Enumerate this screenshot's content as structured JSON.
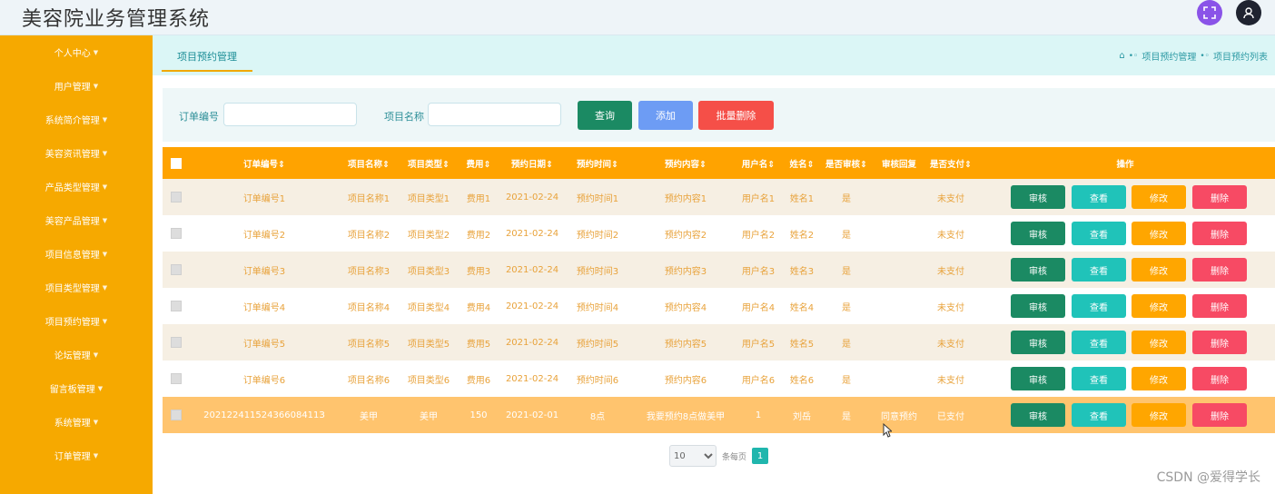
{
  "app": {
    "title": "美容院业务管理系统"
  },
  "topbar": {
    "fullscreen_icon": "expand-icon",
    "user_icon": "user-icon"
  },
  "sidebar": {
    "items": [
      {
        "label": "个人中心"
      },
      {
        "label": "用户管理"
      },
      {
        "label": "系统简介管理"
      },
      {
        "label": "美容资讯管理"
      },
      {
        "label": "产品类型管理"
      },
      {
        "label": "美容产品管理"
      },
      {
        "label": "项目信息管理"
      },
      {
        "label": "项目类型管理"
      },
      {
        "label": "项目预约管理"
      },
      {
        "label": "论坛管理"
      },
      {
        "label": "留言板管理"
      },
      {
        "label": "系统管理"
      },
      {
        "label": "订单管理"
      }
    ]
  },
  "tabs": {
    "active": "项目预约管理"
  },
  "breadcrumb": {
    "level1": "项目预约管理",
    "level2": "项目预约列表"
  },
  "search": {
    "order_label": "订单编号",
    "order_value": "",
    "project_label": "项目名称",
    "project_value": "",
    "query_label": "查询",
    "add_label": "添加",
    "batch_delete_label": "批量删除"
  },
  "table": {
    "headers": [
      "订单编号⇕",
      "项目名称⇕",
      "项目类型⇕",
      "费用⇕",
      "预约日期⇕",
      "预约时间⇕",
      "预约内容⇕",
      "用户名⇕",
      "姓名⇕",
      "是否审核⇕",
      "审核回复",
      "是否支付⇕",
      "操作"
    ],
    "rows": [
      [
        "订单编号1",
        "项目名称1",
        "项目类型1",
        "费用1",
        "2021-02-24",
        "预约时间1",
        "预约内容1",
        "用户名1",
        "姓名1",
        "是",
        "",
        "未支付"
      ],
      [
        "订单编号2",
        "项目名称2",
        "项目类型2",
        "费用2",
        "2021-02-24",
        "预约时间2",
        "预约内容2",
        "用户名2",
        "姓名2",
        "是",
        "",
        "未支付"
      ],
      [
        "订单编号3",
        "项目名称3",
        "项目类型3",
        "费用3",
        "2021-02-24",
        "预约时间3",
        "预约内容3",
        "用户名3",
        "姓名3",
        "是",
        "",
        "未支付"
      ],
      [
        "订单编号4",
        "项目名称4",
        "项目类型4",
        "费用4",
        "2021-02-24",
        "预约时间4",
        "预约内容4",
        "用户名4",
        "姓名4",
        "是",
        "",
        "未支付"
      ],
      [
        "订单编号5",
        "项目名称5",
        "项目类型5",
        "费用5",
        "2021-02-24",
        "预约时间5",
        "预约内容5",
        "用户名5",
        "姓名5",
        "是",
        "",
        "未支付"
      ],
      [
        "订单编号6",
        "项目名称6",
        "项目类型6",
        "费用6",
        "2021-02-24",
        "预约时间6",
        "预约内容6",
        "用户名6",
        "姓名6",
        "是",
        "",
        "未支付"
      ],
      [
        "20212241152436608411З",
        "美甲",
        "美甲",
        "150",
        "2021-02-01",
        "8点",
        "我要预约8点做美甲",
        "1",
        "刘岳",
        "是",
        "同意预约",
        "已支付"
      ]
    ],
    "actions": {
      "audit": "审核",
      "view": "查看",
      "edit": "修改",
      "delete": "删除"
    }
  },
  "pagination": {
    "page_size": "10",
    "per_page_label": "条每页",
    "current_page": "1"
  },
  "watermark": "CSDN @爱得学长",
  "colors": {
    "sidebar": "#f6a900",
    "header": "#ffa300",
    "accent": "#20c3b9"
  }
}
